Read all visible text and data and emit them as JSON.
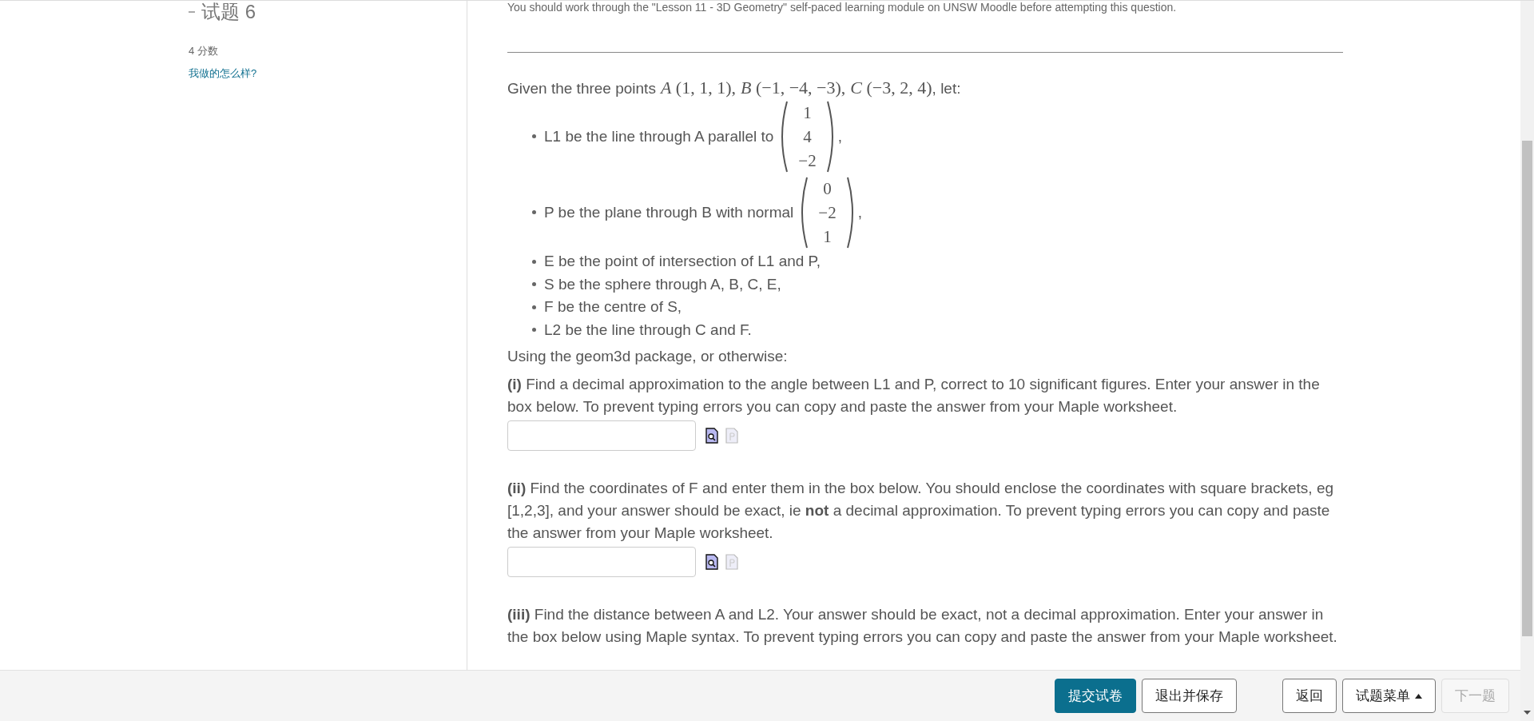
{
  "sidebar": {
    "question_title": "试题 6",
    "marks": "4 分数",
    "feedback_link": "我做的怎么样?"
  },
  "note": "You should work through the \"Lesson 11 - 3D Geometry\" self-paced learning module on UNSW Moodle before attempting this question.",
  "intro": {
    "text": "Given the three points",
    "points": [
      {
        "name": "A",
        "coords": "(1, 1, 1),"
      },
      {
        "name": "B",
        "coords": "(−1, −4, −3),"
      },
      {
        "name": "C",
        "coords": "(−3, 2, 4)"
      }
    ],
    "suffix": ", let:"
  },
  "definitions": [
    {
      "kind": "vector",
      "text": "L1 be the line through A parallel to",
      "vector": [
        "1",
        "4",
        "−2"
      ],
      "suffix": ","
    },
    {
      "kind": "vector",
      "text": "P be the plane through B with normal",
      "vector": [
        "0",
        "−2",
        "1"
      ],
      "suffix": ","
    },
    {
      "kind": "text",
      "text": "E be the point of intersection of L1 and P,"
    },
    {
      "kind": "text",
      "text": "S be the sphere through A, B, C, E,"
    },
    {
      "kind": "text",
      "text": "F be the centre of S,"
    },
    {
      "kind": "text",
      "text": "L2 be the line through C and F."
    }
  ],
  "lead": "Using the geom3d package, or otherwise:",
  "parts": [
    {
      "kind": "with_field",
      "text": "**(i)** Find a decimal approximation to the angle between L1 and P, correct to 10 significant figures. Enter your answer in the box below. To prevent typing errors you can copy and paste the answer from your Maple worksheet."
    },
    {
      "kind": "with_field",
      "text": "**(ii)** Find the coordinates of F and enter them in the box below. You should enclose the coordinates with square brackets, eg [1,2,3], and your answer should be exact, ie **not** a decimal approximation. To prevent typing errors you can copy and paste the answer from your Maple worksheet."
    },
    {
      "kind": "text_only",
      "text": "**(iii)** Find the distance between A and L2. Your answer should be exact, not a decimal approximation.  Enter your answer in the box below using Maple syntax. To prevent typing errors you can copy and paste the answer from your Maple worksheet."
    }
  ],
  "nav_buttons": {
    "left": [
      {
        "label": "提交试卷",
        "kind": "primary",
        "disabled": false
      },
      {
        "label": "退出并保存",
        "kind": "plain",
        "disabled": false
      }
    ],
    "right": [
      {
        "label": "返回",
        "kind": "plain",
        "disabled": false
      },
      {
        "label": "试题菜单",
        "kind": "menu",
        "disabled": false
      },
      {
        "label": "下一题",
        "kind": "plain",
        "disabled": true
      }
    ]
  }
}
